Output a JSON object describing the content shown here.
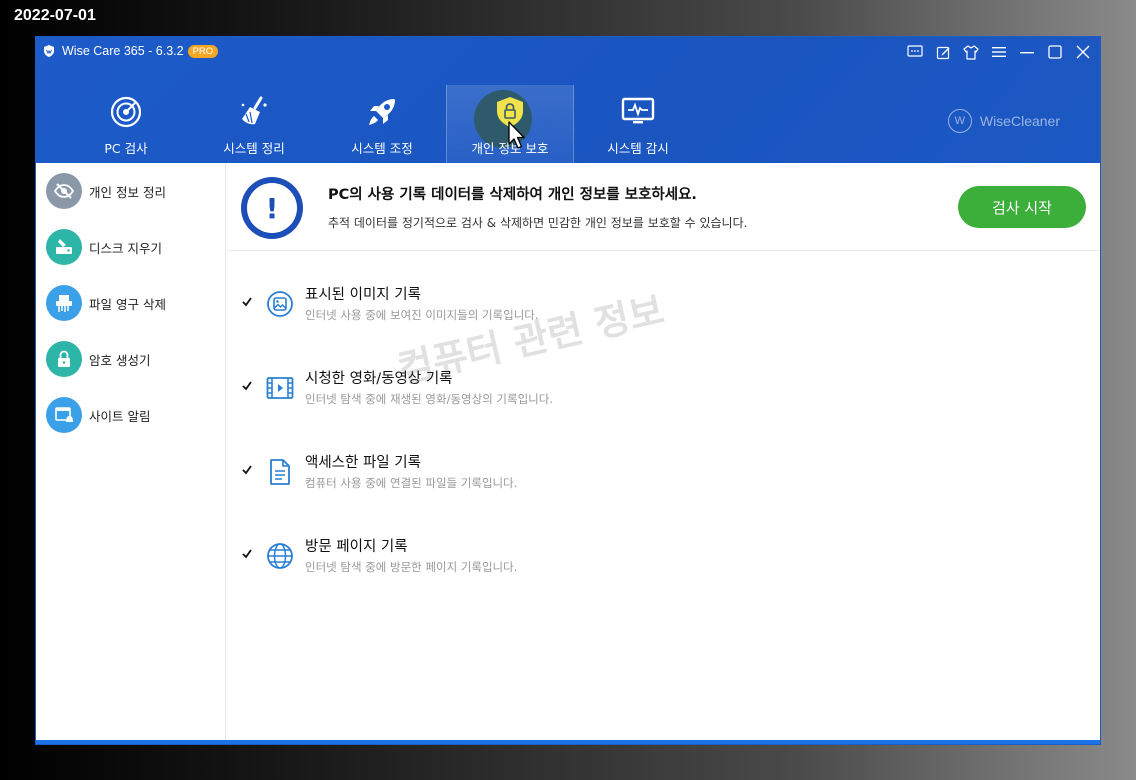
{
  "date_stamp": "2022-07-01",
  "app": {
    "title": "Wise Care 365 - 6.3.2",
    "badge": "PRO",
    "brand": "WiseCleaner",
    "brand_logo_letter": "W"
  },
  "window_controls": [
    "feedback-icon",
    "edit-icon",
    "skin-icon",
    "menu-icon",
    "minimize-icon",
    "maximize-icon",
    "close-icon"
  ],
  "nav": {
    "tabs": [
      {
        "label": "PC 검사",
        "icon": "radar-icon"
      },
      {
        "label": "시스템 정리",
        "icon": "broom-icon"
      },
      {
        "label": "시스템 조정",
        "icon": "rocket-icon"
      },
      {
        "label": "개인 정보 보호",
        "icon": "shield-lock-icon",
        "active": true
      },
      {
        "label": "시스템 감시",
        "icon": "monitor-icon"
      }
    ]
  },
  "sidebar": {
    "items": [
      {
        "label": "개인 정보 정리",
        "icon": "eye-off-icon",
        "color": "#8a98a8"
      },
      {
        "label": "디스크 지우기",
        "icon": "disk-eraser-icon",
        "color": "#2db5a8"
      },
      {
        "label": "파일 영구 삭제",
        "icon": "shredder-icon",
        "color": "#3aa0e8"
      },
      {
        "label": "암호 생성기",
        "icon": "lock-icon",
        "color": "#2db5a8"
      },
      {
        "label": "사이트 알림",
        "icon": "web-bell-icon",
        "color": "#3aa0e8"
      }
    ]
  },
  "banner": {
    "title": "PC의 사용 기록 데이터를 삭제하여 개인 정보를 보호하세요.",
    "description": "추적 데이터를 정기적으로 검사 & 삭제하면 민감한 개인 정보를 보호할 수 있습니다.",
    "scan_button": "검사 시작"
  },
  "items": [
    {
      "title": "표시된 이미지 기록",
      "description": "인터넷 사용 중에 보여진 이미지들의 기록입니다.",
      "icon": "image-icon",
      "checked": true
    },
    {
      "title": "시청한 영화/동영상 기록",
      "description": "인터넷 탐색 중에 재생된 영화/동영상의 기록입니다.",
      "icon": "film-icon",
      "checked": true
    },
    {
      "title": "액세스한 파일 기록",
      "description": "컴퓨터 사용 중에 연결된 파일들 기록입니다.",
      "icon": "document-icon",
      "checked": true
    },
    {
      "title": "방문 페이지 기록",
      "description": "인터넷 탐색 중에 방문한 페이지 기록입니다.",
      "icon": "globe-icon",
      "checked": true
    }
  ],
  "watermark": "컴퓨터 관련 정보",
  "colors": {
    "header": "#1d5bc9",
    "accent_green": "#3cae3a",
    "item_icon": "#2a7fd4"
  }
}
